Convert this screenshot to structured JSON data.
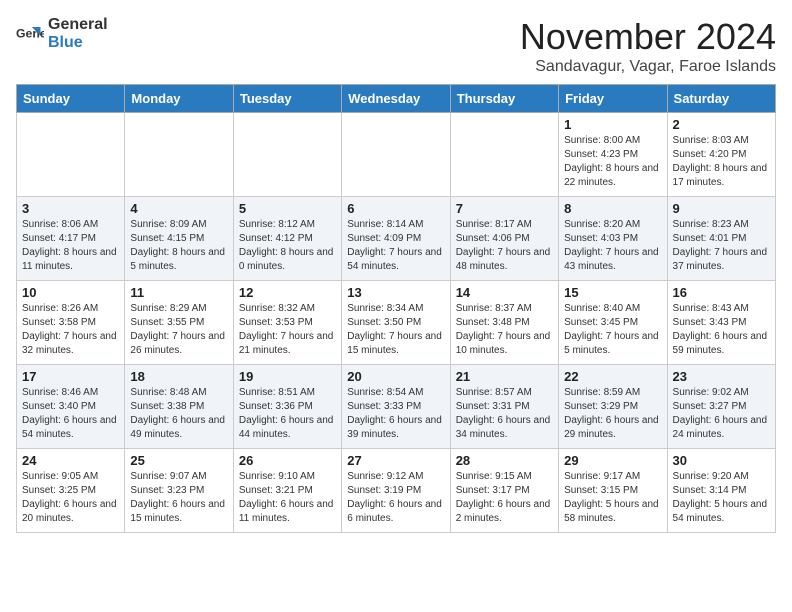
{
  "header": {
    "logo_general": "General",
    "logo_blue": "Blue",
    "month_title": "November 2024",
    "location": "Sandavagur, Vagar, Faroe Islands"
  },
  "weekdays": [
    "Sunday",
    "Monday",
    "Tuesday",
    "Wednesday",
    "Thursday",
    "Friday",
    "Saturday"
  ],
  "weeks": [
    [
      {
        "day": "",
        "info": ""
      },
      {
        "day": "",
        "info": ""
      },
      {
        "day": "",
        "info": ""
      },
      {
        "day": "",
        "info": ""
      },
      {
        "day": "",
        "info": ""
      },
      {
        "day": "1",
        "info": "Sunrise: 8:00 AM\nSunset: 4:23 PM\nDaylight: 8 hours and 22 minutes."
      },
      {
        "day": "2",
        "info": "Sunrise: 8:03 AM\nSunset: 4:20 PM\nDaylight: 8 hours and 17 minutes."
      }
    ],
    [
      {
        "day": "3",
        "info": "Sunrise: 8:06 AM\nSunset: 4:17 PM\nDaylight: 8 hours and 11 minutes."
      },
      {
        "day": "4",
        "info": "Sunrise: 8:09 AM\nSunset: 4:15 PM\nDaylight: 8 hours and 5 minutes."
      },
      {
        "day": "5",
        "info": "Sunrise: 8:12 AM\nSunset: 4:12 PM\nDaylight: 8 hours and 0 minutes."
      },
      {
        "day": "6",
        "info": "Sunrise: 8:14 AM\nSunset: 4:09 PM\nDaylight: 7 hours and 54 minutes."
      },
      {
        "day": "7",
        "info": "Sunrise: 8:17 AM\nSunset: 4:06 PM\nDaylight: 7 hours and 48 minutes."
      },
      {
        "day": "8",
        "info": "Sunrise: 8:20 AM\nSunset: 4:03 PM\nDaylight: 7 hours and 43 minutes."
      },
      {
        "day": "9",
        "info": "Sunrise: 8:23 AM\nSunset: 4:01 PM\nDaylight: 7 hours and 37 minutes."
      }
    ],
    [
      {
        "day": "10",
        "info": "Sunrise: 8:26 AM\nSunset: 3:58 PM\nDaylight: 7 hours and 32 minutes."
      },
      {
        "day": "11",
        "info": "Sunrise: 8:29 AM\nSunset: 3:55 PM\nDaylight: 7 hours and 26 minutes."
      },
      {
        "day": "12",
        "info": "Sunrise: 8:32 AM\nSunset: 3:53 PM\nDaylight: 7 hours and 21 minutes."
      },
      {
        "day": "13",
        "info": "Sunrise: 8:34 AM\nSunset: 3:50 PM\nDaylight: 7 hours and 15 minutes."
      },
      {
        "day": "14",
        "info": "Sunrise: 8:37 AM\nSunset: 3:48 PM\nDaylight: 7 hours and 10 minutes."
      },
      {
        "day": "15",
        "info": "Sunrise: 8:40 AM\nSunset: 3:45 PM\nDaylight: 7 hours and 5 minutes."
      },
      {
        "day": "16",
        "info": "Sunrise: 8:43 AM\nSunset: 3:43 PM\nDaylight: 6 hours and 59 minutes."
      }
    ],
    [
      {
        "day": "17",
        "info": "Sunrise: 8:46 AM\nSunset: 3:40 PM\nDaylight: 6 hours and 54 minutes."
      },
      {
        "day": "18",
        "info": "Sunrise: 8:48 AM\nSunset: 3:38 PM\nDaylight: 6 hours and 49 minutes."
      },
      {
        "day": "19",
        "info": "Sunrise: 8:51 AM\nSunset: 3:36 PM\nDaylight: 6 hours and 44 minutes."
      },
      {
        "day": "20",
        "info": "Sunrise: 8:54 AM\nSunset: 3:33 PM\nDaylight: 6 hours and 39 minutes."
      },
      {
        "day": "21",
        "info": "Sunrise: 8:57 AM\nSunset: 3:31 PM\nDaylight: 6 hours and 34 minutes."
      },
      {
        "day": "22",
        "info": "Sunrise: 8:59 AM\nSunset: 3:29 PM\nDaylight: 6 hours and 29 minutes."
      },
      {
        "day": "23",
        "info": "Sunrise: 9:02 AM\nSunset: 3:27 PM\nDaylight: 6 hours and 24 minutes."
      }
    ],
    [
      {
        "day": "24",
        "info": "Sunrise: 9:05 AM\nSunset: 3:25 PM\nDaylight: 6 hours and 20 minutes."
      },
      {
        "day": "25",
        "info": "Sunrise: 9:07 AM\nSunset: 3:23 PM\nDaylight: 6 hours and 15 minutes."
      },
      {
        "day": "26",
        "info": "Sunrise: 9:10 AM\nSunset: 3:21 PM\nDaylight: 6 hours and 11 minutes."
      },
      {
        "day": "27",
        "info": "Sunrise: 9:12 AM\nSunset: 3:19 PM\nDaylight: 6 hours and 6 minutes."
      },
      {
        "day": "28",
        "info": "Sunrise: 9:15 AM\nSunset: 3:17 PM\nDaylight: 6 hours and 2 minutes."
      },
      {
        "day": "29",
        "info": "Sunrise: 9:17 AM\nSunset: 3:15 PM\nDaylight: 5 hours and 58 minutes."
      },
      {
        "day": "30",
        "info": "Sunrise: 9:20 AM\nSunset: 3:14 PM\nDaylight: 5 hours and 54 minutes."
      }
    ]
  ]
}
